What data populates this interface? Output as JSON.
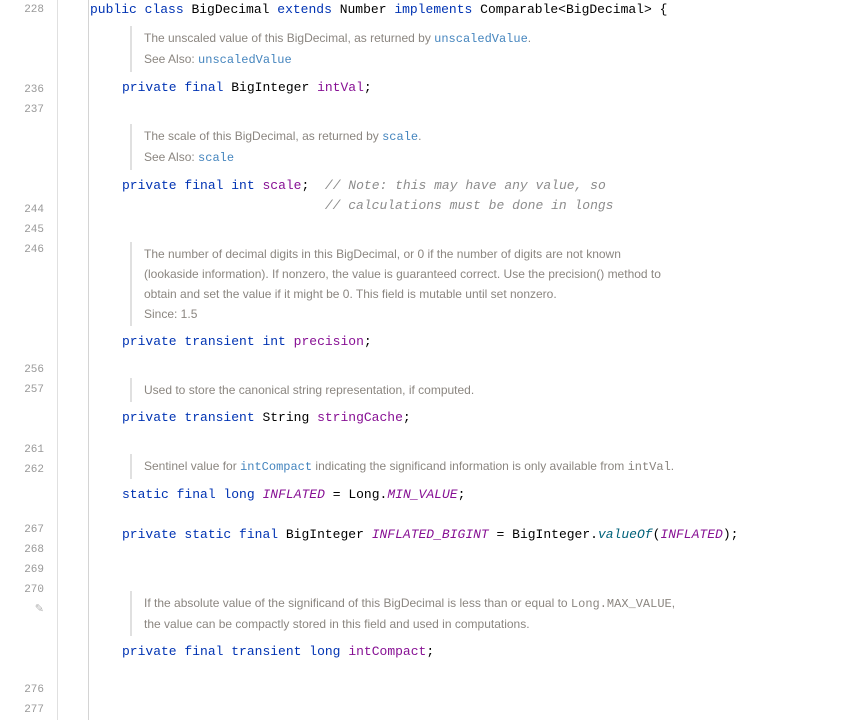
{
  "gutter": {
    "lines": [
      "228",
      "",
      "",
      "",
      "236",
      "237",
      "",
      "",
      "",
      "",
      "244",
      "245",
      "246",
      "",
      "",
      "",
      "",
      "",
      "256",
      "257",
      "",
      "",
      "261",
      "262",
      "",
      "",
      "267",
      "268",
      "269",
      "270",
      "",
      "",
      "",
      "",
      "276",
      "277"
    ]
  },
  "editIcon": "✎",
  "code": {
    "classDecl": {
      "public": "public",
      "class": "class",
      "name": "BigDecimal",
      "extends": "extends",
      "superClass": "Number",
      "implements": "implements",
      "interface": "Comparable<BigDecimal>",
      "brace": " {"
    },
    "docIntVal": {
      "line1a": "The unscaled value of this BigDecimal, as returned by ",
      "link1": "unscaledValue",
      "dot1": ".",
      "seeAlso": "See Also: ",
      "seeLink": "unscaledValue"
    },
    "intVal": {
      "private": "private",
      "final": "final",
      "type": "BigInteger",
      "name": "intVal",
      "semi": ";"
    },
    "docScale": {
      "line1a": "The scale of this BigDecimal, as returned by ",
      "link1": "scale",
      "dot1": ".",
      "seeAlso": "See Also: ",
      "seeLink": "scale"
    },
    "scaleField": {
      "private": "private",
      "final": "final",
      "int": "int",
      "name": "scale",
      "semi": ";",
      "comment1": "  // Note: this may have any value, so",
      "comment2": "                          // calculations must be done in longs"
    },
    "docPrecision": {
      "line1": "The number of decimal digits in this BigDecimal, or 0 if the number of digits are not known",
      "line2": "(lookaside information). If nonzero, the value is guaranteed correct. Use the precision() method to",
      "line3": "obtain and set the value if it might be 0. This field is mutable until set nonzero.",
      "since": "Since: 1.5"
    },
    "precision": {
      "private": "private",
      "transient": "transient",
      "int": "int",
      "name": "precision",
      "semi": ";"
    },
    "docStringCache": {
      "line1": "Used to store the canonical string representation, if computed."
    },
    "stringCache": {
      "private": "private",
      "transient": "transient",
      "type": "String",
      "name": "stringCache",
      "semi": ";"
    },
    "docInflated": {
      "line1a": "Sentinel value for ",
      "link1": "intCompact",
      "line1b": " indicating the significand information is only available from ",
      "code1": "intVal",
      "dot1": "."
    },
    "inflated": {
      "static": "static",
      "final": "final",
      "long": "long",
      "name": "INFLATED",
      "eq": " = ",
      "obj": "Long",
      "dot": ".",
      "val": "MIN_VALUE",
      "semi": ";"
    },
    "inflatedBigint": {
      "private": "private",
      "static": "static",
      "final": "final",
      "type": "BigInteger",
      "name": "INFLATED_BIGINT",
      "eq": " = ",
      "obj": "BigInteger",
      "dot": ".",
      "method": "valueOf",
      "open": "(",
      "arg": "INFLATED",
      "close": ")",
      "semi": ";"
    },
    "docIntCompact": {
      "line1a": "If the absolute value of the significand of this BigDecimal is less than or equal to ",
      "code1": "Long.MAX_VALUE",
      "line1c": ",",
      "line2": "the value can be compactly stored in this field and used in computations."
    },
    "intCompact": {
      "private": "private",
      "final": "final",
      "transient": "transient",
      "long": "long",
      "name": "intCompact",
      "semi": ";"
    }
  }
}
